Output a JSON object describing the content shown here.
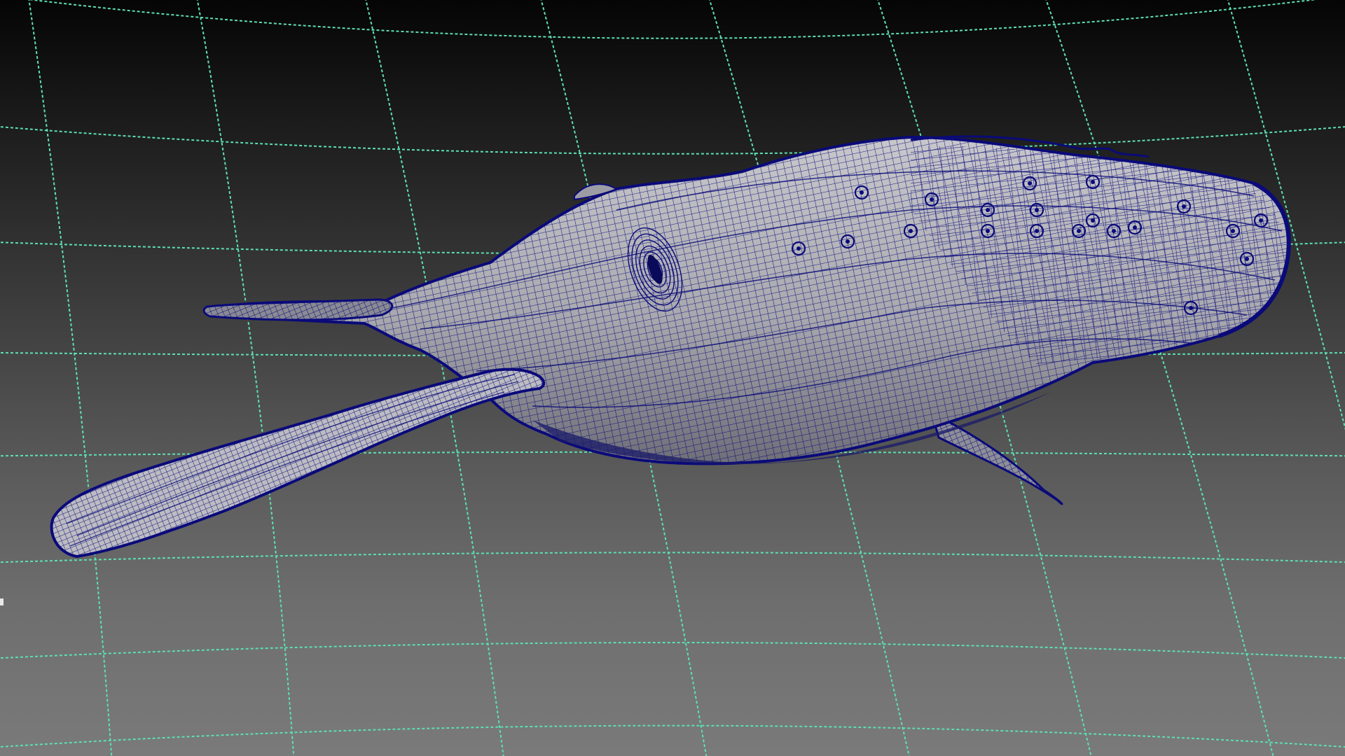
{
  "viewport": {
    "name": "perspective-viewport",
    "grid_color": "#5de0b0",
    "wireframe_color": "#0a0a7a",
    "surface_color": "#b4b4b8",
    "background_top": "#050505",
    "background_bottom": "#7a7a7a",
    "display_mode": "shaded-wireframe",
    "grid_visible": true
  },
  "model": {
    "icon": "whale-mesh"
  }
}
